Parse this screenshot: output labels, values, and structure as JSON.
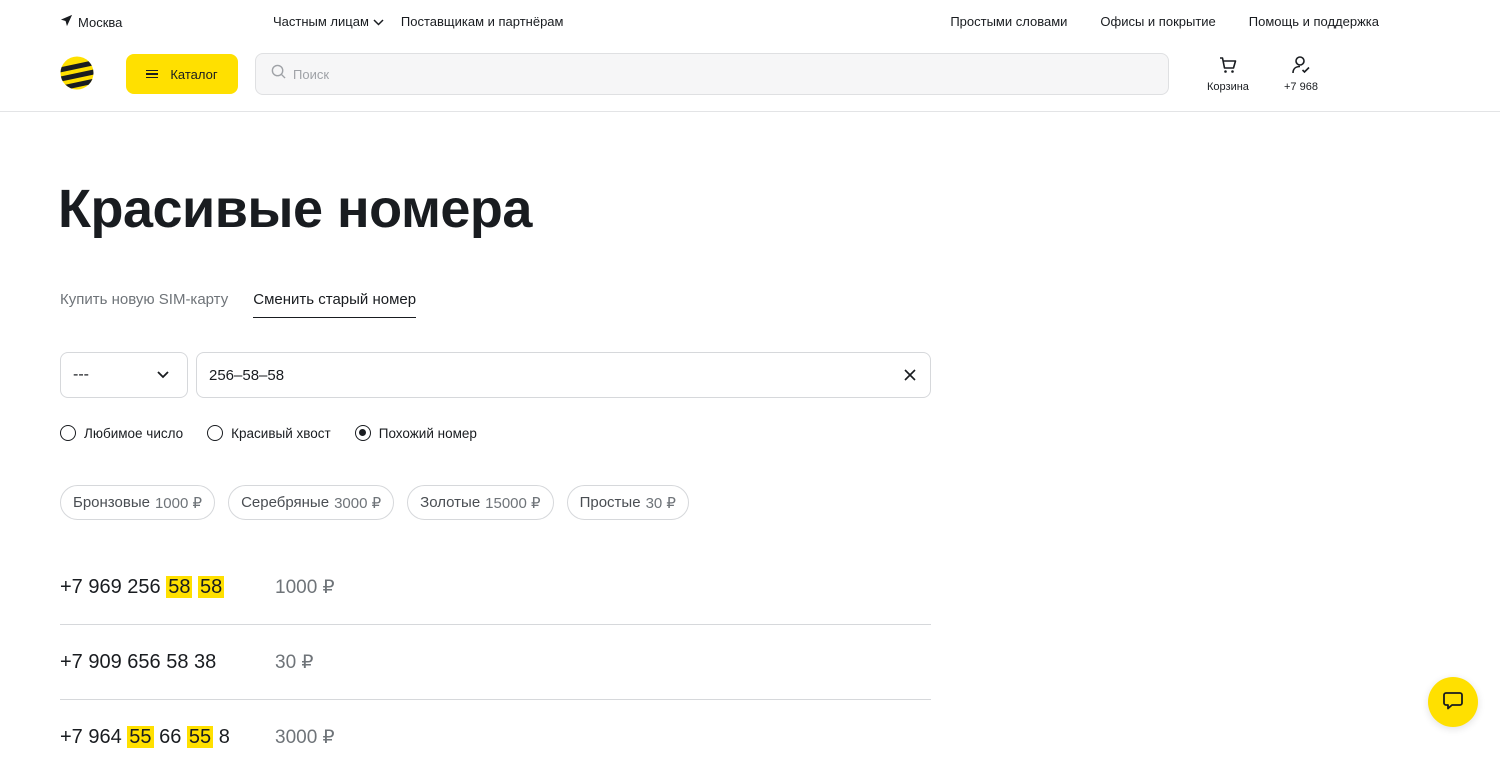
{
  "topbar": {
    "city": "Москва",
    "left_nav": [
      "Частным лицам",
      "Поставщикам и партнёрам"
    ],
    "right_nav": [
      "Простыми словами",
      "Офисы и покрытие",
      "Помощь и поддержка"
    ]
  },
  "header": {
    "catalog_label": "Каталог",
    "search_placeholder": "Поиск",
    "cart_label": "Корзина",
    "account_label": "+7 968"
  },
  "page": {
    "title": "Красивые номера",
    "tabs": [
      {
        "label": "Купить новую SIM-карту",
        "active": false
      },
      {
        "label": "Сменить старый номер",
        "active": true
      }
    ]
  },
  "search_form": {
    "select_value": "---",
    "number_value": "256–58–58"
  },
  "radios": [
    {
      "label": "Любимое число",
      "checked": false
    },
    {
      "label": "Красивый хвост",
      "checked": false
    },
    {
      "label": "Похожий номер",
      "checked": true
    }
  ],
  "chips": [
    {
      "name": "Бронзовые",
      "price": "1000 ₽"
    },
    {
      "name": "Серебряные",
      "price": "3000 ₽"
    },
    {
      "name": "Золотые",
      "price": "15000 ₽"
    },
    {
      "name": "Простые",
      "price": "30 ₽"
    }
  ],
  "results": [
    {
      "number_parts": [
        {
          "text": "+7 969 256 ",
          "hl": false
        },
        {
          "text": "58",
          "hl": true
        },
        {
          "text": " ",
          "hl": false
        },
        {
          "text": "58",
          "hl": true
        }
      ],
      "price": "1000 ₽"
    },
    {
      "number_parts": [
        {
          "text": "+7 909 656 58 38",
          "hl": false
        }
      ],
      "price": "30 ₽"
    },
    {
      "number_parts": [
        {
          "text": "+7 964 ",
          "hl": false
        },
        {
          "text": "55",
          "hl": true
        },
        {
          "text": " 66 ",
          "hl": false
        },
        {
          "text": "55",
          "hl": true
        },
        {
          "text": " 8",
          "hl": false
        }
      ],
      "price": "3000 ₽"
    }
  ],
  "colors": {
    "brand_yellow": "#ffe000",
    "text": "#191c20",
    "muted": "#6f7479"
  },
  "icons": {
    "city": "location-arrow-icon",
    "cart": "cart-icon",
    "account": "user-check-icon",
    "search": "search-icon",
    "chat": "chat-bubble-icon"
  }
}
